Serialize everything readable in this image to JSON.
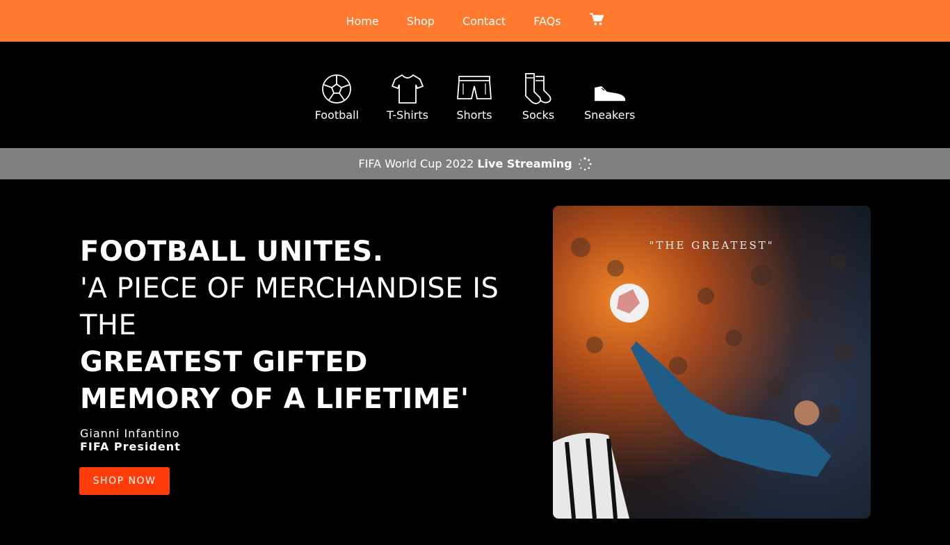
{
  "nav": {
    "items": [
      {
        "label": "Home"
      },
      {
        "label": "Shop"
      },
      {
        "label": "Contact"
      },
      {
        "label": "FAQs"
      }
    ],
    "cart_icon": "shopping-cart-icon",
    "background": "#ff7a2f"
  },
  "categories": [
    {
      "label": "Football",
      "icon": "football-icon"
    },
    {
      "label": "T-Shirts",
      "icon": "tshirt-icon"
    },
    {
      "label": "Shorts",
      "icon": "shorts-icon"
    },
    {
      "label": "Socks",
      "icon": "socks-icon"
    },
    {
      "label": "Sneakers",
      "icon": "sneaker-icon"
    }
  ],
  "banner": {
    "text": "FIFA World Cup 2022",
    "bold": "Live Streaming",
    "icon": "loading-spinner-icon",
    "background": "#808080"
  },
  "hero": {
    "line1": "FOOTBALL UNITES.",
    "line2": "'A PIECE OF MERCHANDISE IS THE",
    "line3": "GREATEST GIFTED MEMORY OF A LIFETIME'",
    "author": "Gianni Infantino",
    "role": "FIFA President",
    "button": "SHOP NOW",
    "button_color": "#ff3d0a",
    "image_caption": "\"THE GREATEST\""
  }
}
